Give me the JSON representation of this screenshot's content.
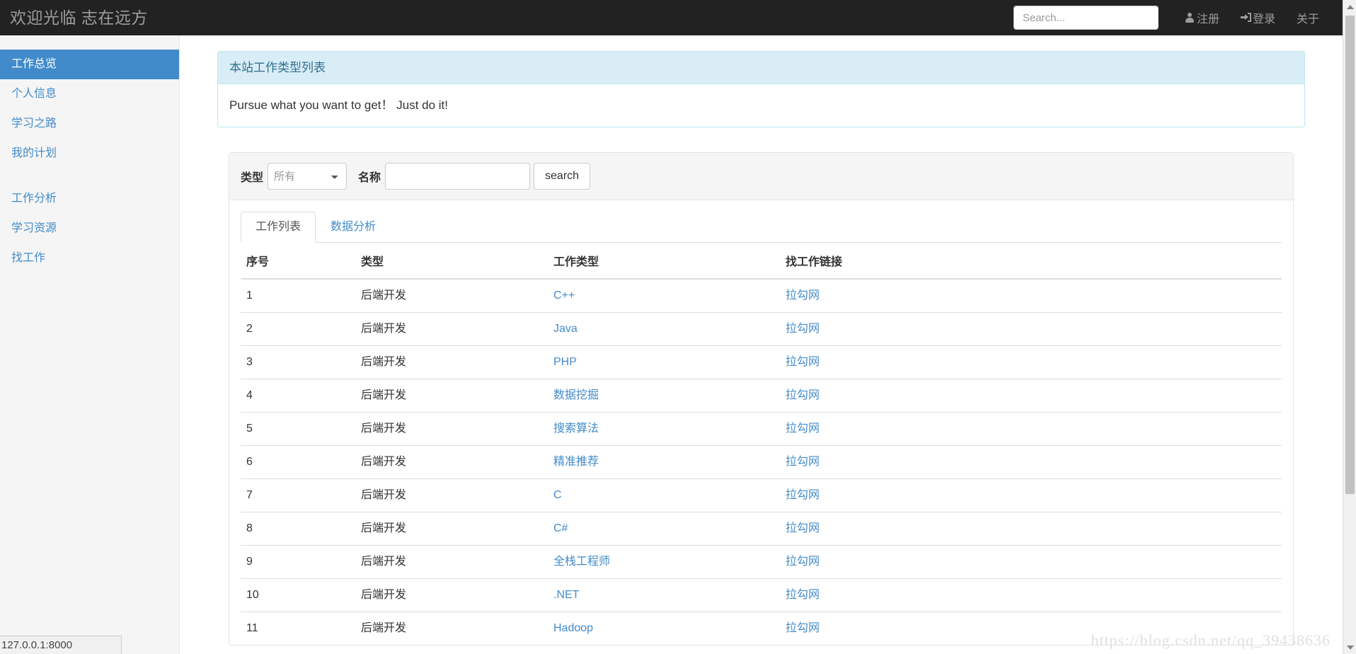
{
  "navbar": {
    "brand": "欢迎光临 志在远方",
    "search_placeholder": "Search...",
    "search_value": "",
    "links": [
      {
        "label": "注册",
        "icon": "user-icon"
      },
      {
        "label": "登录",
        "icon": "sign-in-icon"
      },
      {
        "label": "关于",
        "icon": ""
      }
    ]
  },
  "sidebar": {
    "items": [
      {
        "label": "工作总览",
        "active": true
      },
      {
        "label": "个人信息",
        "active": false
      },
      {
        "label": "学习之路",
        "active": false
      },
      {
        "label": "我的计划",
        "active": false
      },
      {
        "label": "工作分析",
        "active": false
      },
      {
        "label": "学习资源",
        "active": false
      },
      {
        "label": "找工作",
        "active": false
      }
    ]
  },
  "panel": {
    "heading": "本站工作类型列表",
    "body": "Pursue what you want to get！ Just do it!"
  },
  "filter": {
    "type_label": "类型",
    "type_selected": "所有",
    "type_options": [
      "所有"
    ],
    "name_label": "名称",
    "name_value": "",
    "name_placeholder": "",
    "search_button": "search"
  },
  "tabs": [
    {
      "label": "工作列表",
      "active": true
    },
    {
      "label": "数据分析",
      "active": false
    }
  ],
  "table": {
    "headers": [
      "序号",
      "类型",
      "工作类型",
      "找工作链接"
    ],
    "rows": [
      {
        "idx": "1",
        "type": "后端开发",
        "job": "C++",
        "link": "拉勾网"
      },
      {
        "idx": "2",
        "type": "后端开发",
        "job": "Java",
        "link": "拉勾网"
      },
      {
        "idx": "3",
        "type": "后端开发",
        "job": "PHP",
        "link": "拉勾网"
      },
      {
        "idx": "4",
        "type": "后端开发",
        "job": "数据挖掘",
        "link": "拉勾网"
      },
      {
        "idx": "5",
        "type": "后端开发",
        "job": "搜索算法",
        "link": "拉勾网"
      },
      {
        "idx": "6",
        "type": "后端开发",
        "job": "精准推荐",
        "link": "拉勾网"
      },
      {
        "idx": "7",
        "type": "后端开发",
        "job": "C",
        "link": "拉勾网"
      },
      {
        "idx": "8",
        "type": "后端开发",
        "job": "C#",
        "link": "拉勾网"
      },
      {
        "idx": "9",
        "type": "后端开发",
        "job": "全栈工程师",
        "link": "拉勾网"
      },
      {
        "idx": "10",
        "type": "后端开发",
        "job": ".NET",
        "link": "拉勾网"
      },
      {
        "idx": "11",
        "type": "后端开发",
        "job": "Hadoop",
        "link": "拉勾网"
      }
    ]
  },
  "statusbar": {
    "url": "127.0.0.1:8000"
  },
  "watermark": {
    "text": "https://blog.csdn.net/qq_39438636"
  },
  "colors": {
    "navbar_bg": "#222222",
    "sidebar_bg": "#f5f5f5",
    "accent": "#428bca",
    "panel_header_bg": "#d9edf7",
    "panel_border": "#bce8f1",
    "panel_header_text": "#31708f"
  }
}
